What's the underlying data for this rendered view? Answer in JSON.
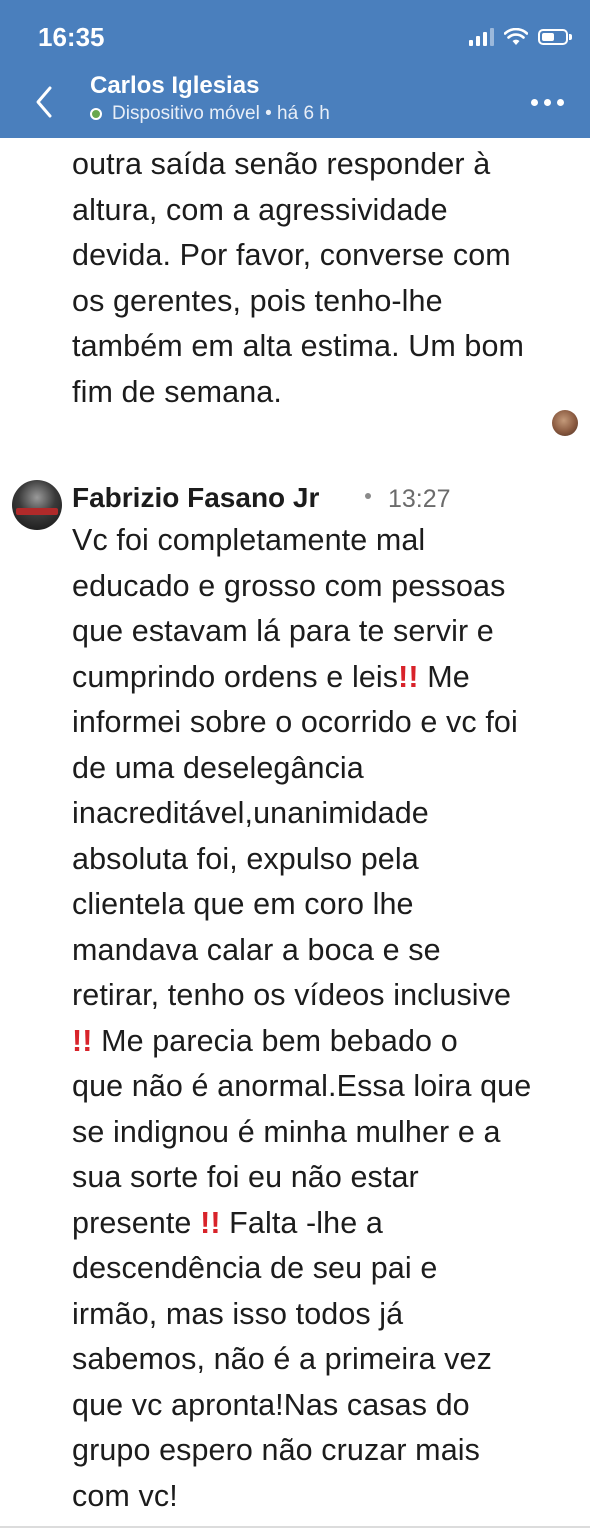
{
  "status_bar": {
    "time": "16:35"
  },
  "header": {
    "contact_name": "Carlos Iglesias",
    "contact_status": "Dispositivo móvel • há 6 h",
    "back_icon": "chevron-left-icon",
    "more_icon": "more-horizontal-icon"
  },
  "messages": [
    {
      "lines": [
        "outra saída senão responder à",
        "altura, com a agressividade",
        "devida. Por favor, converse com",
        "os gerentes, pois tenho-lhe",
        "também em alta estima. Um bom",
        "fim de semana."
      ]
    },
    {
      "sender": "Fabrizio Fasano Jr",
      "time": "13:27",
      "lines": [
        "Vc foi completamente mal",
        "educado e grosso com pessoas",
        "que estavam lá para te servir e",
        "cumprindo ordens e leis‼️ Me",
        "informei sobre o ocorrido e vc foi",
        "de uma deselegância",
        "inacreditável,unanimidade",
        "absoluta foi, expulso pela",
        "clientela que em coro lhe",
        "mandava calar a boca e se",
        "retirar, tenho os vídeos inclusive",
        "‼️ Me parecia bem   bebado o",
        "que não é anormal.Essa loira que",
        "se indignou é minha mulher e a",
        "sua sorte foi eu não estar",
        "presente ‼️ Falta -lhe a",
        "descendência de seu pai e",
        "irmão, mas isso todos já",
        "sabemos, não é a primeira vez",
        "que vc apronta!Nas casas do",
        "grupo espero não cruzar mais",
        "com vc!"
      ]
    }
  ],
  "colors": {
    "header_bg": "#4a7fbd",
    "online": "#6aa84f",
    "emoji_red": "#d8232a"
  }
}
